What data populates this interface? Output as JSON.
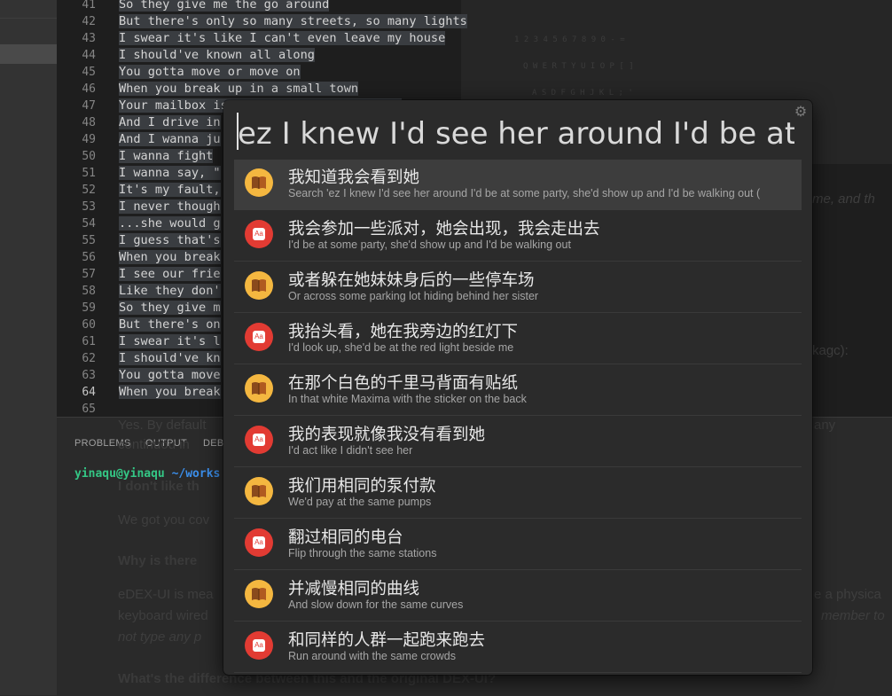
{
  "editor": {
    "lines": [
      {
        "n": "41",
        "text": "So they give me the go around"
      },
      {
        "n": "42",
        "text": "But there's only so many streets, so many lights"
      },
      {
        "n": "43",
        "text": "I swear it's like I can't even leave my house"
      },
      {
        "n": "44",
        "text": "I should've known all along"
      },
      {
        "n": "45",
        "text": "You gotta move or move on"
      },
      {
        "n": "46",
        "text": "When you break up in a small town"
      },
      {
        "n": "47",
        "text": "Your mailbox is seven minutes from mine"
      },
      {
        "n": "48",
        "text": "And I drive in"
      },
      {
        "n": "49",
        "text": "And I wanna ju"
      },
      {
        "n": "50",
        "text": "I wanna fight"
      },
      {
        "n": "51",
        "text": "I wanna say, \""
      },
      {
        "n": "52",
        "text": "It's my fault,"
      },
      {
        "n": "53",
        "text": "I never though"
      },
      {
        "n": "54",
        "text": "...she would g"
      },
      {
        "n": "55",
        "text": "I guess that's"
      },
      {
        "n": "56",
        "text": "When you break"
      },
      {
        "n": "57",
        "text": "I see our frie"
      },
      {
        "n": "58",
        "text": "Like they don'"
      },
      {
        "n": "59",
        "text": "So they give m"
      },
      {
        "n": "60",
        "text": "But there's on"
      },
      {
        "n": "61",
        "text": "I swear it's l"
      },
      {
        "n": "62",
        "text": "I should've kn"
      },
      {
        "n": "63",
        "text": "You gotta move"
      },
      {
        "n": "64",
        "text": "When you break"
      },
      {
        "n": "65",
        "text": ""
      }
    ],
    "current_line": "64"
  },
  "panel": {
    "tabs": [
      "PROBLEMS",
      "OUTPUT",
      "DEB"
    ],
    "terminal_user": "yinaqu@yinaqu",
    "terminal_path": " ~/works"
  },
  "background_doc": [
    "me, and th",
    "kagc):",
    "Yes. By default",
    "any",
    "continuou in",
    "I don't like th",
    "We got you cov",
    "Why is there",
    "eDEX-UI is mea",
    "e a physica",
    "keyboard wired",
    "member to",
    "not type any p",
    "What's the difference between this and the original DEX-UI?"
  ],
  "launcher": {
    "query": "ez I knew I'd see her around I'd be at some party",
    "results": [
      {
        "icon": "book-icon",
        "title": "我知道我会看到她",
        "subtitle": "Search 'ez I knew I'd see her around I'd be at some party, she'd show up and I'd be walking out (",
        "active": true
      },
      {
        "icon": "translate-icon",
        "title": "我会参加一些派对，她会出现，我会走出去",
        "subtitle": "I'd be at some party, she'd show up and I'd be walking out",
        "active": false
      },
      {
        "icon": "book-icon",
        "title": "或者躲在她妹妹身后的一些停车场",
        "subtitle": "Or across some parking lot hiding behind her sister",
        "active": false
      },
      {
        "icon": "translate-icon",
        "title": "我抬头看，她在我旁边的红灯下",
        "subtitle": "I'd look up, she'd be at the red light beside me",
        "active": false
      },
      {
        "icon": "book-icon",
        "title": "在那个白色的千里马背面有贴纸",
        "subtitle": "In that white Maxima with the sticker on the back",
        "active": false
      },
      {
        "icon": "translate-icon",
        "title": "我的表现就像我没有看到她",
        "subtitle": "I'd act like I didn't see her",
        "active": false
      },
      {
        "icon": "book-icon",
        "title": "我们用相同的泵付款",
        "subtitle": "We'd pay at the same pumps",
        "active": false
      },
      {
        "icon": "translate-icon",
        "title": "翻过相同的电台",
        "subtitle": "Flip through the same stations",
        "active": false
      },
      {
        "icon": "book-icon",
        "title": "并减慢相同的曲线",
        "subtitle": "And slow down for the same curves",
        "active": false
      },
      {
        "icon": "translate-icon",
        "title": "和同样的人群一起跑来跑去",
        "subtitle": "Run around with the same crowds",
        "active": false
      }
    ]
  },
  "colors": {
    "accent_book": "#f4b740",
    "accent_translate": "#e23b33",
    "terminal_user": "#34c785",
    "terminal_path": "#3b8eea"
  }
}
